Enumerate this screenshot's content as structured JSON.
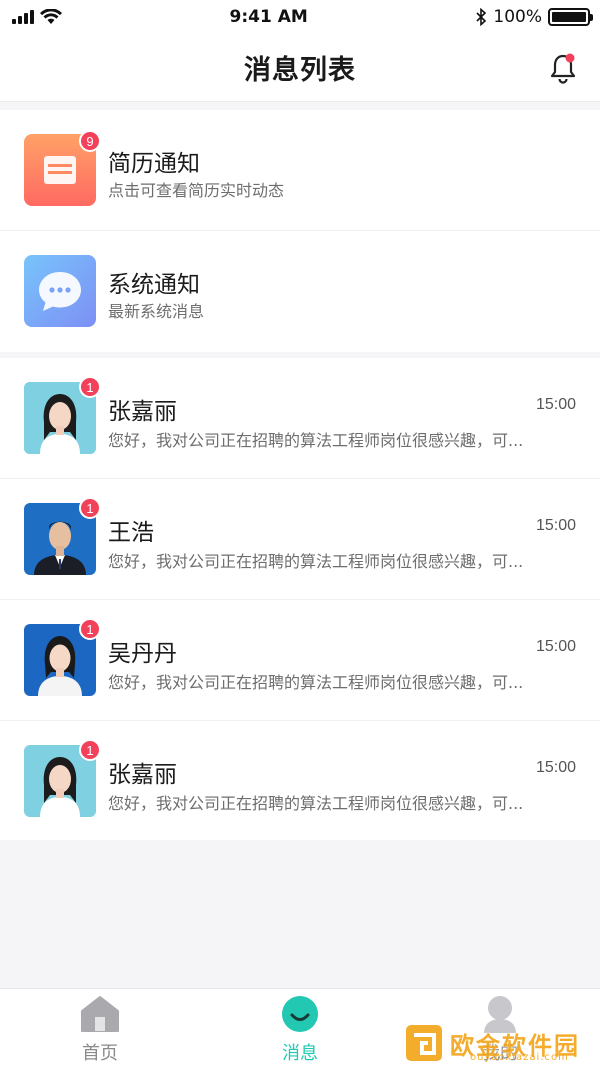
{
  "status_bar": {
    "time": "9:41 AM",
    "battery": "100%"
  },
  "header": {
    "title": "消息列表"
  },
  "notices": [
    {
      "title": "简历通知",
      "subtitle": "点击可查看简历实时动态",
      "badge": "9",
      "icon": "resume-icon"
    },
    {
      "title": "系统通知",
      "subtitle": "最新系统消息",
      "icon": "chat-bubble-icon"
    }
  ],
  "chats": [
    {
      "name": "张嘉丽",
      "preview": "您好，我对公司正在招聘的算法工程师岗位很感兴趣，可...",
      "time": "15:00",
      "badge": "1"
    },
    {
      "name": "王浩",
      "preview": "您好，我对公司正在招聘的算法工程师岗位很感兴趣，可...",
      "time": "15:00",
      "badge": "1"
    },
    {
      "name": "吴丹丹",
      "preview": "您好，我对公司正在招聘的算法工程师岗位很感兴趣，可...",
      "time": "15:00",
      "badge": "1"
    },
    {
      "name": "张嘉丽",
      "preview": "您好，我对公司正在招聘的算法工程师岗位很感兴趣，可...",
      "time": "15:00",
      "badge": "1"
    }
  ],
  "tabs": [
    {
      "label": "首页",
      "icon": "home-icon"
    },
    {
      "label": "消息",
      "icon": "message-smile-icon",
      "active": true
    },
    {
      "label": "我的",
      "icon": "profile-icon"
    }
  ],
  "watermark": {
    "text": "欧金软件园",
    "url": "ouyaoxiazai.com"
  },
  "colors": {
    "accent": "#22c8b2",
    "badge": "#f2415a"
  }
}
